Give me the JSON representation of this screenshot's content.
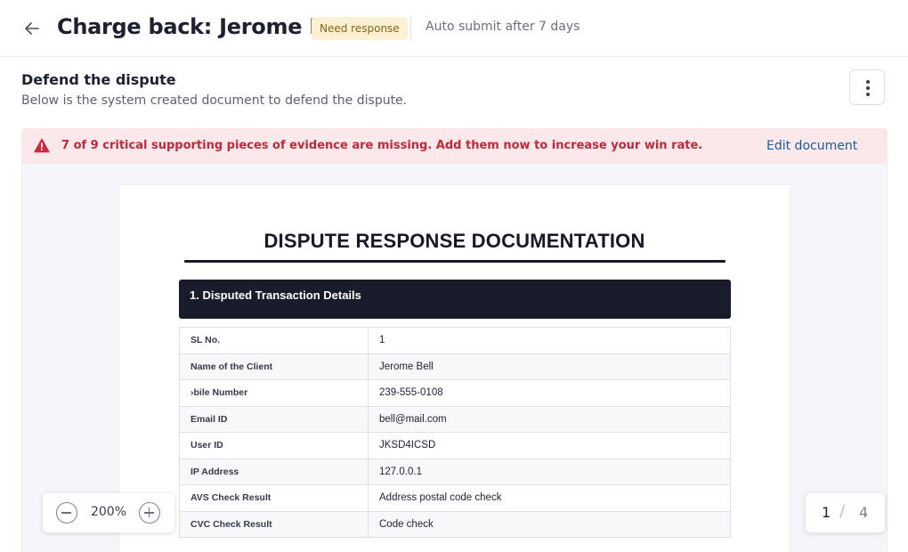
{
  "header": {
    "title": "Charge back: Jerome Bell",
    "status_badge": "Need response",
    "auto_submit": "Auto submit after 7 days"
  },
  "section": {
    "title": "Defend the dispute",
    "subtitle": "Below is the system created document to defend the dispute."
  },
  "alert": {
    "message": "7 of 9 critical supporting pieces of evidence are missing. Add them now to increase your win rate.",
    "action_label": "Edit document"
  },
  "document": {
    "title": "DISPUTE RESPONSE DOCUMENTATION",
    "section_heading": "1. Disputed Transaction Details",
    "rows": [
      {
        "label": "SL No.",
        "value": "1"
      },
      {
        "label": "Name of the Client",
        "value": "Jerome Bell"
      },
      {
        "label": "›bile Number",
        "value": "239-555-0108"
      },
      {
        "label": "Email ID",
        "value": "bell@mail.com"
      },
      {
        "label": "User ID",
        "value": "JKSD4ICSD"
      },
      {
        "label": "IP Address",
        "value": "127.0.0.1"
      },
      {
        "label": "AVS Check Result",
        "value": "Address postal code check"
      },
      {
        "label": "CVC Check Result",
        "value": "Code check"
      }
    ]
  },
  "zoom": {
    "level": "200%"
  },
  "pagination": {
    "current": "1",
    "separator": "/",
    "total": "4"
  },
  "colors": {
    "badge_bg": "#fbf1d2",
    "alert_bg": "#fbe8ea",
    "alert_text": "#c2283b",
    "link": "#1d5a9c",
    "doc_header_bar": "#191c2b"
  },
  "icons": [
    "arrow-left-icon",
    "more-vertical-icon",
    "warning-triangle-icon",
    "minus-circle-icon",
    "plus-circle-icon"
  ]
}
